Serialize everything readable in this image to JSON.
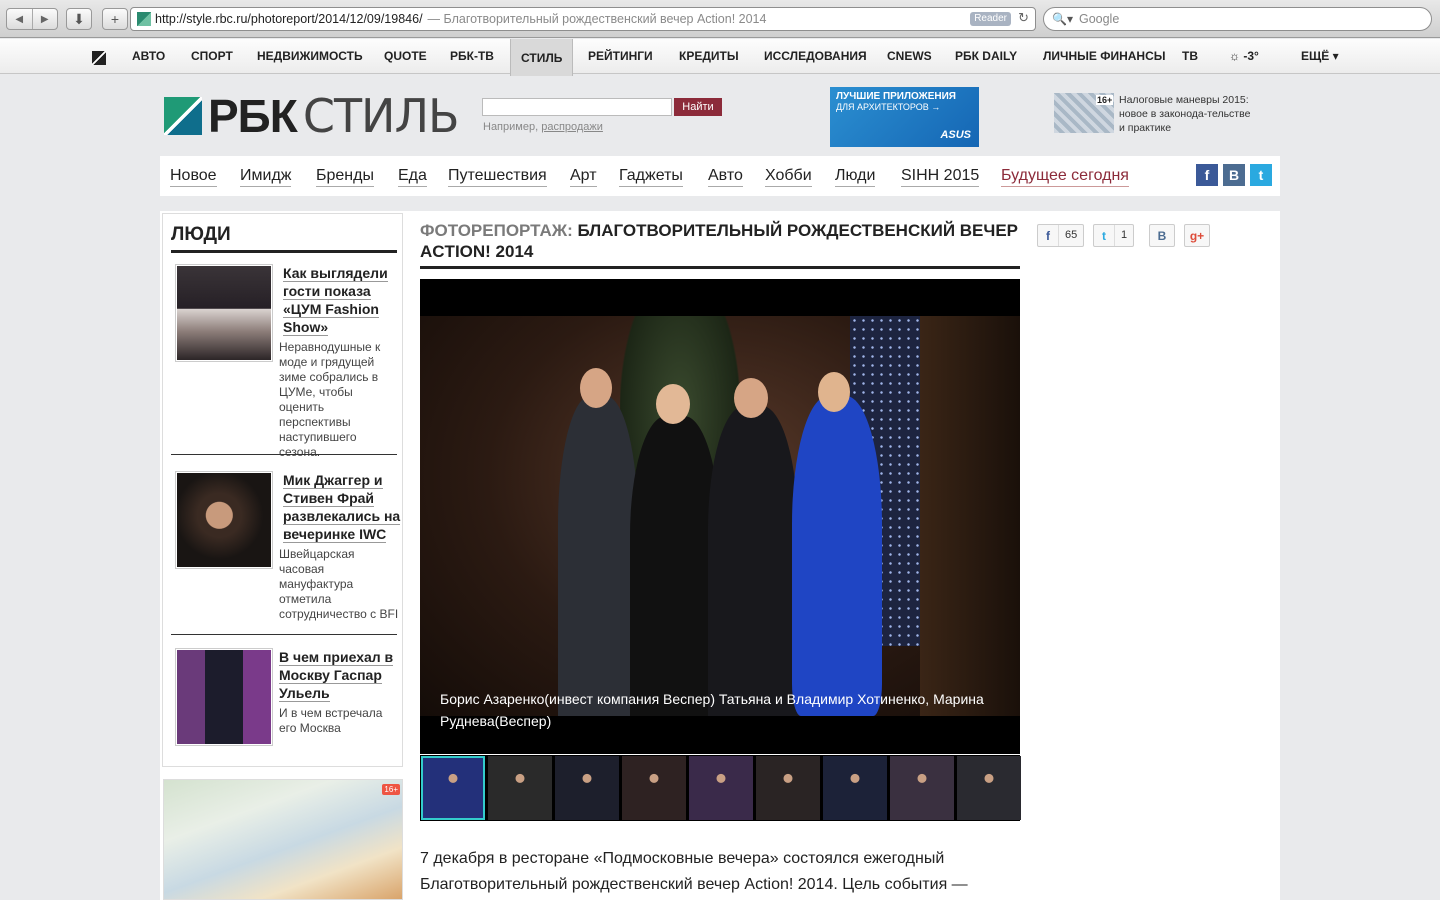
{
  "browser": {
    "url": "http://style.rbc.ru/photoreport/2014/12/09/19846/",
    "title_suffix": "— Благотворительный рождественский вечер Action! 2014",
    "reader_label": "Reader",
    "search_placeholder": "Google",
    "back_glyph": "◀",
    "forward_glyph": "▶",
    "download_glyph": "⬇",
    "newtab_glyph": "+",
    "reload_glyph": "↻",
    "magnifier_glyph": "🔍▾"
  },
  "topbar": {
    "items": [
      "АВТО",
      "СПОРТ",
      "НЕДВИЖИМОСТЬ",
      "QUOTE",
      "РБК-ТВ",
      "СТИЛЬ",
      "РЕЙТИНГИ",
      "КРЕДИТЫ",
      "ИССЛЕДОВАНИЯ",
      "CNEWS",
      "РБК DAILY",
      "ЛИЧНЫЕ ФИНАНСЫ",
      "ТВ"
    ],
    "active": "СТИЛЬ",
    "weather": "-3°",
    "weather_icon": "☼",
    "more": "ЕЩЁ",
    "more_arrow": "▾"
  },
  "header": {
    "logo_rbk": "РБК",
    "logo_style": "СТИЛЬ",
    "search_button": "Найти",
    "search_hint": "Например,",
    "search_hint_link": "распродажи",
    "ad_asus_line1": "ЛУЧШИЕ ПРИЛОЖЕНИЯ",
    "ad_asus_line2": "ДЛЯ АРХИТЕКТОРОВ →",
    "ad_asus_brand": "ASUS",
    "ad_tax_badge": "16+",
    "ad_tax_text": "Налоговые маневры 2015: новое в законода-тельстве и практике"
  },
  "categories": [
    "Новое",
    "Имидж",
    "Бренды",
    "Еда",
    "Путешествия",
    "Арт",
    "Гаджеты",
    "Авто",
    "Хобби",
    "Люди",
    "SIHH 2015",
    "Будущее сегодня"
  ],
  "social": {
    "fb": "f",
    "vk": "B",
    "tw": "t"
  },
  "sidebar": {
    "title": "ЛЮДИ",
    "items": [
      {
        "title": "Как выглядели гости показа «ЦУМ Fashion Show»",
        "desc": "Неравнодушные к моде и грядущей зиме собрались в ЦУМе, чтобы оценить перспективы наступившего сезона."
      },
      {
        "title": "Мик Джаггер и Стивен Фрай развлекались на вечеринке IWC",
        "desc": "Швейцарская часовая мануфактура отметила сотрудничество с BFI"
      },
      {
        "title": "В чем приехал в Москву Гаспар Ульель",
        "desc": "И в чем встречала его Москва"
      }
    ],
    "ad_badge": "16+"
  },
  "article": {
    "kicker": "ФОТОРЕПОРТАЖ:",
    "title": "БЛАГОТВОРИТЕЛЬНЫЙ РОЖДЕСТВЕНСКИЙ ВЕЧЕР ACTION! 2014",
    "caption": "Борис Азаренко(инвест компания Веспер) Татьяна и Владимир Хотиненко, Марина Руднева(Веспер)",
    "lead": "7 декабря в ресторане «Подмосковные вечера» состоялся ежегодный Благотворительный рождественский вечер Action! 2014. Цель события —",
    "thumb_count": 9,
    "selected_thumb": 0
  },
  "share": {
    "fb_icon": "f",
    "fb_count": "65",
    "tw_icon": "t",
    "tw_count": "1",
    "vk_icon": "B",
    "gplus_icon": "g+"
  }
}
